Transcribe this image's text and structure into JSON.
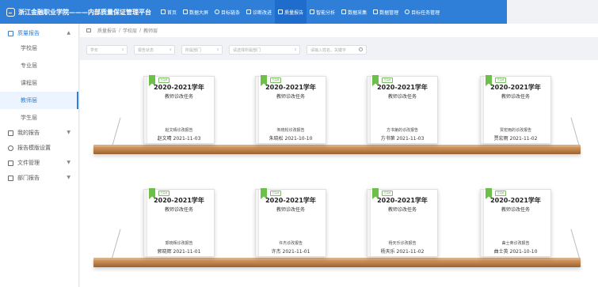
{
  "header": {
    "title": "浙江金融职业学院———内部质量保证管理平台",
    "nav": [
      {
        "label": "首页",
        "icon": "home-icon"
      },
      {
        "label": "数据大屏",
        "icon": "monitor-icon"
      },
      {
        "label": "目标链条",
        "icon": "target-icon"
      },
      {
        "label": "诊断改进",
        "icon": "clipboard-icon"
      },
      {
        "label": "质量报告",
        "icon": "report-icon"
      },
      {
        "label": "智能分析",
        "icon": "chart-icon"
      },
      {
        "label": "数据采集",
        "icon": "collect-icon"
      },
      {
        "label": "数据管理",
        "icon": "database-icon"
      },
      {
        "label": "目标任务管理",
        "icon": "task-icon"
      }
    ]
  },
  "sidebar": {
    "parent": {
      "label": "质量报告"
    },
    "children": [
      "学校层",
      "专业层",
      "课程层",
      "教师层",
      "学生层"
    ],
    "others": [
      {
        "label": "我的报告",
        "icon": "user-icon"
      },
      {
        "label": "报告模版设置",
        "icon": "gear-icon"
      },
      {
        "label": "文件管理",
        "icon": "folder-icon"
      },
      {
        "label": "部门报告",
        "icon": "doc-icon"
      }
    ]
  },
  "breadcrumb": [
    "质量报告",
    "/",
    "学校层",
    "/",
    "教师层"
  ],
  "filters": {
    "sel1": "学年",
    "sel2": "报告状态",
    "sel3": "所属部门",
    "sel4": "请选择所属部门",
    "search_placeholder": "请输入姓名，关键字"
  },
  "books": [
    {
      "year": "2020-2021学年",
      "title": "教师诊改任务",
      "report": "赵文晴诊改报告",
      "meta": "赵文晴 2021-11-03"
    },
    {
      "year": "2020-2021学年",
      "title": "教师诊改任务",
      "report": "朱晓松诊改报告",
      "meta": "朱晓松 2021-10-10"
    },
    {
      "year": "2020-2021学年",
      "title": "教师诊改任务",
      "report": "方书第的诊改报告",
      "meta": "方书第 2021-11-03"
    },
    {
      "year": "2020-2021学年",
      "title": "教师诊改任务",
      "report": "贾宏雨的诊改报告",
      "meta": "贾宏雨 2021-11-02"
    },
    {
      "year": "2020-2021学年",
      "title": "教师诊改任务",
      "report": "郭晓辉诊改报告",
      "meta": "郭晓辉 2021-11-01"
    },
    {
      "year": "2020-2021学年",
      "title": "教师诊改任务",
      "report": "许杰诊改报告",
      "meta": "许杰 2021-11-01"
    },
    {
      "year": "2020-2021学年",
      "title": "教师诊改任务",
      "report": "杨天乐诊改报告",
      "meta": "杨天乐 2021-11-02"
    },
    {
      "year": "2020-2021学年",
      "title": "教师诊改任务",
      "report": "曲士英诊改报告",
      "meta": "曲士英 2021-10-10"
    }
  ],
  "stamp": "已完成"
}
